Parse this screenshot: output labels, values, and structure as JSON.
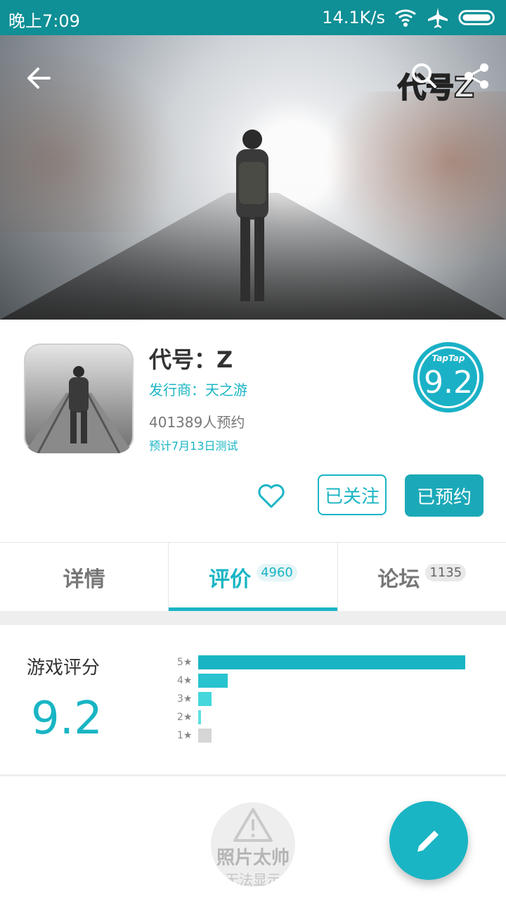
{
  "status_bar": {
    "time": "晚上7:09",
    "speed": "14.1K/s"
  },
  "hero": {
    "logo_text": "代号Z"
  },
  "game": {
    "title": "代号：Z",
    "publisher": "发行商：天之游",
    "reservations": "401389人预约",
    "test_date": "预计7月13日测试",
    "score_brand": "TapTap",
    "score": "9.2"
  },
  "actions": {
    "follow_label": "已关注",
    "reserved_label": "已预约"
  },
  "tabs": [
    {
      "label": "详情",
      "count": ""
    },
    {
      "label": "评价",
      "count": "4960"
    },
    {
      "label": "论坛",
      "count": "1135"
    }
  ],
  "rating": {
    "title": "游戏评分",
    "score": "9.2",
    "distribution": [
      {
        "stars": "5★",
        "fraction": 1.0,
        "color": "#19b5c4"
      },
      {
        "stars": "4★",
        "fraction": 0.11,
        "color": "#28c3cf"
      },
      {
        "stars": "3★",
        "fraction": 0.05,
        "color": "#45d7dc"
      },
      {
        "stars": "2★",
        "fraction": 0.01,
        "color": "#5fe0e3"
      },
      {
        "stars": "1★",
        "fraction": 0.05,
        "color": "#d6d6d6"
      }
    ]
  },
  "placeholder": {
    "line1": "照片太帅",
    "line2": "无法显示"
  },
  "colors": {
    "accent": "#19b5c4",
    "status_bar": "#0f8f96"
  }
}
